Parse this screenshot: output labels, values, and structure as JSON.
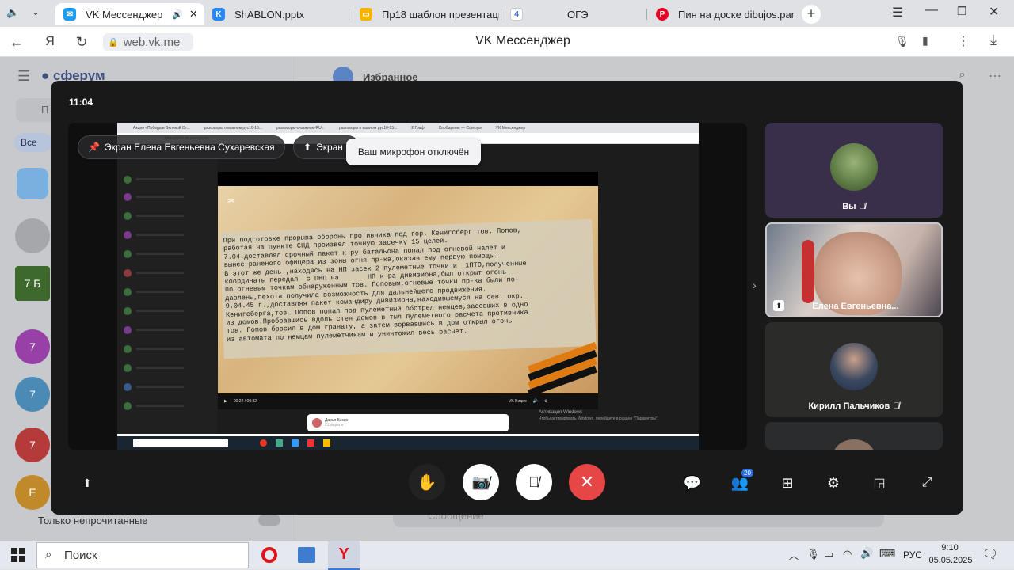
{
  "browser": {
    "tabs": [
      {
        "title": "VK Мессенджер",
        "active": true
      },
      {
        "title": "ShABLON.pptx"
      },
      {
        "title": "Пр18 шаблон презентаци"
      },
      {
        "title": "ОГЭ"
      },
      {
        "title": "Пин на доске dibujos.para"
      }
    ],
    "url": "web.vk.me",
    "page_title": "VK Мессенджер"
  },
  "background_page": {
    "brand": "сферум",
    "header_title": "Избранное",
    "search_placeholder": "П",
    "filter_chip": "Все",
    "avatar_7b": "7 Б",
    "avatar_7": "7",
    "avatar_e": "Е",
    "unread_only_label": "Только непрочитанные",
    "message_placeholder": "Сообщение"
  },
  "call": {
    "clock": "11:04",
    "pins": [
      {
        "label": "Экран Елена Евгеньевна Сухаревская"
      },
      {
        "label": "Экран"
      }
    ],
    "mic_off_notice": "Ваш микрофон отключён",
    "participants": [
      {
        "name": "Вы",
        "mic_muted": true
      },
      {
        "name": "Елена Евгеньевна...",
        "screen_sharing": true
      },
      {
        "name": "Кирилл Пальчиков",
        "mic_muted": true
      }
    ],
    "participants_count": "20",
    "accent_red": "#e64646"
  },
  "shared_screen": {
    "tabs": [
      "Акция «Победа в Великой От...",
      "разговоры о важном рус10-15...",
      "разговоры-о-важном-RU...",
      "разговоры о важном рус10-15...",
      "2.Граф",
      "Сообщение — Сферум",
      "VK Мессенджер"
    ],
    "address": "https://web.vk.me/convo/...",
    "document_lines": [
      "При подготовке прорыва обороны противника под гор. Кенигсберг тов. Попов,",
      "работая на пункте СНД произвел точную засечку 15 целей.",
      "7.04.доставлял срочный пакет к-ру батальона попал под огневой налет и",
      "вынес раненого офицера из зоны огня пр-ка,оказав ему первую помощь.",
      "В этот же день ,находясь на НП засек 2 пулеметные точки и  1ПТО,полученные",
      "координаты передал  с ПНП на       НП к-ра дивизиона,был открыт огонь",
      "по огневым точкам обнаруженным тов. Поповым,огневые точки пр-ка были по-",
      "давлены,пехота получила возможность для дальнейшего продвижения.",
      "9.04.45 г.,доставляя пакет командиру дивизиона,находившемуся на сев. окр.",
      "Кенигсберга,тов. Попов попал под пулеметный обстрел немцев,засевших в одно",
      "из домов.Пробравшись вдоль стен домов в тыл пулеметного расчета противника",
      "тов. Попов бросил в дом гранату, а затем ворвавшись в дом открыл огонь",
      "из автомата по немцам пулеметчикам и уничтожил весь расчет."
    ],
    "video_time": "00:22 / 00:32",
    "video_source": "VK Видео",
    "windows_activation_title": "Активация Windows",
    "windows_activation_text": "Чтобы активировать Windows, перейдите в раздел \"Параметры\".",
    "chat_input_name": "Дарья Кисин",
    "chat_input_sub": "21 апреля"
  },
  "taskbar": {
    "search_label": "Поиск",
    "lang": "РУС",
    "time": "9:10",
    "date": "05.05.2025"
  }
}
